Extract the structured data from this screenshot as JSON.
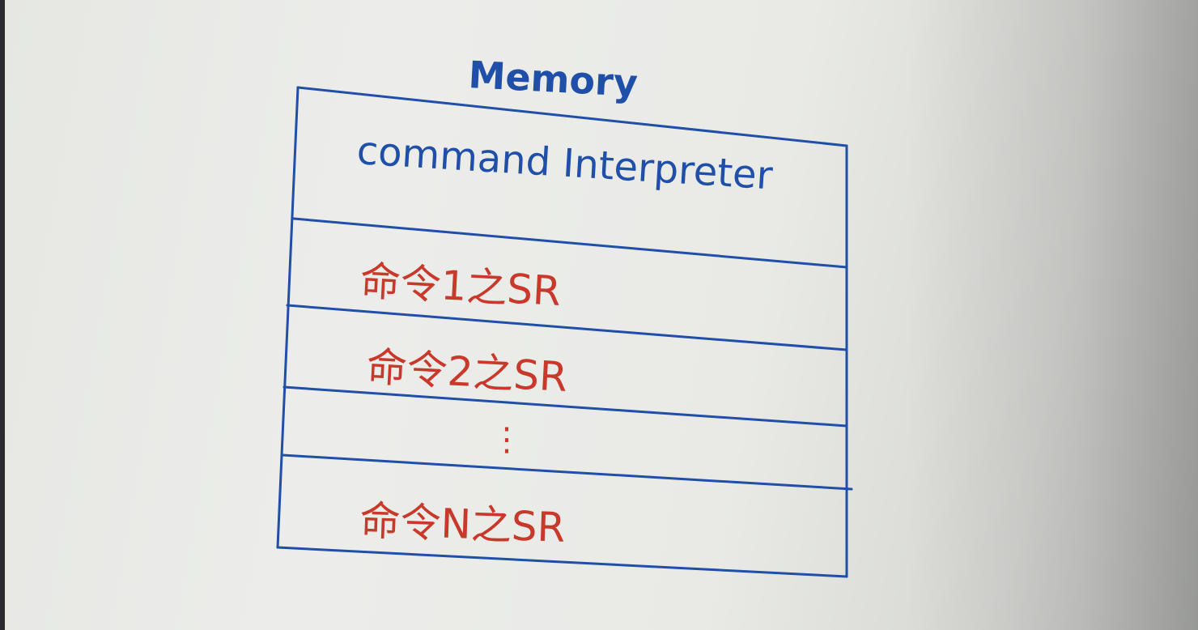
{
  "diagram": {
    "title": "Memory",
    "sections": [
      {
        "label": "command Interpreter",
        "color": "#1f4fa8"
      },
      {
        "label": "命令1之SR",
        "color": "#c8392b"
      },
      {
        "label": "命令2之SR",
        "color": "#c8392b"
      },
      {
        "label": "⋮",
        "color": "#c8392b"
      },
      {
        "label": "命令N之SR",
        "color": "#c8392b"
      }
    ],
    "colors": {
      "frame": "#1f4fa8",
      "ink_blue": "#1f4fa8",
      "ink_red": "#c8392b",
      "paper": "#e9eae6"
    }
  }
}
